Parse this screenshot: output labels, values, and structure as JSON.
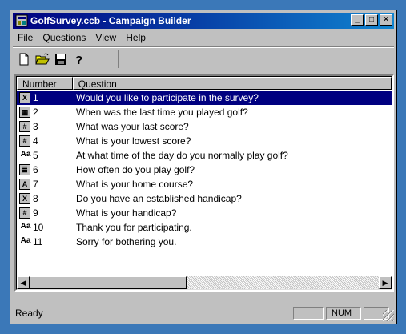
{
  "window": {
    "title": "GolfSurvey.ccb - Campaign Builder",
    "controls": {
      "minimize": "_",
      "maximize": "□",
      "close": "×"
    }
  },
  "menu": [
    {
      "label": "File",
      "mnemonic": "F"
    },
    {
      "label": "Questions",
      "mnemonic": "Q"
    },
    {
      "label": "View",
      "mnemonic": "V"
    },
    {
      "label": "Help",
      "mnemonic": "H"
    }
  ],
  "toolbar": [
    {
      "name": "new-document-icon"
    },
    {
      "name": "open-folder-icon"
    },
    {
      "name": "save-disk-icon"
    },
    {
      "name": "help-question-icon"
    }
  ],
  "list": {
    "columns": [
      "Number",
      "Question"
    ],
    "rows": [
      {
        "number": "1",
        "question": "Would you like to participate in the survey?",
        "icon": "yes-no-icon",
        "glyph": "X",
        "selected": true
      },
      {
        "number": "2",
        "question": "When was the last time you played golf?",
        "icon": "date-icon",
        "glyph": "▦",
        "selected": false
      },
      {
        "number": "3",
        "question": "What was your last score?",
        "icon": "number-icon",
        "glyph": "#",
        "selected": false
      },
      {
        "number": "4",
        "question": "What is your lowest score?",
        "icon": "number-icon",
        "glyph": "#",
        "selected": false
      },
      {
        "number": "5",
        "question": "At what time of the day do you normally play golf?",
        "icon": "text-icon",
        "glyph": "Aa",
        "selected": false
      },
      {
        "number": "6",
        "question": "How often do you play golf?",
        "icon": "list-choice-icon",
        "glyph": "≣",
        "selected": false
      },
      {
        "number": "7",
        "question": "What is your home course?",
        "icon": "text-answer-icon",
        "glyph": "A",
        "selected": false
      },
      {
        "number": "8",
        "question": "Do you have an established handicap?",
        "icon": "yes-no-icon",
        "glyph": "X",
        "selected": false
      },
      {
        "number": "9",
        "question": "What is your handicap?",
        "icon": "number-icon",
        "glyph": "#",
        "selected": false
      },
      {
        "number": "10",
        "question": "Thank you for participating.",
        "icon": "text-icon",
        "glyph": "Aa",
        "selected": false
      },
      {
        "number": "11",
        "question": "Sorry for bothering you.",
        "icon": "text-icon",
        "glyph": "Aa",
        "selected": false
      }
    ]
  },
  "scrollbar": {
    "left_arrow": "◀",
    "right_arrow": "▶"
  },
  "status": {
    "text": "Ready",
    "num_indicator": "NUM"
  },
  "colors": {
    "titlebar": "#000080",
    "selection": "#000080",
    "chrome": "#c0c0c0",
    "frame": "#3b78b8"
  }
}
